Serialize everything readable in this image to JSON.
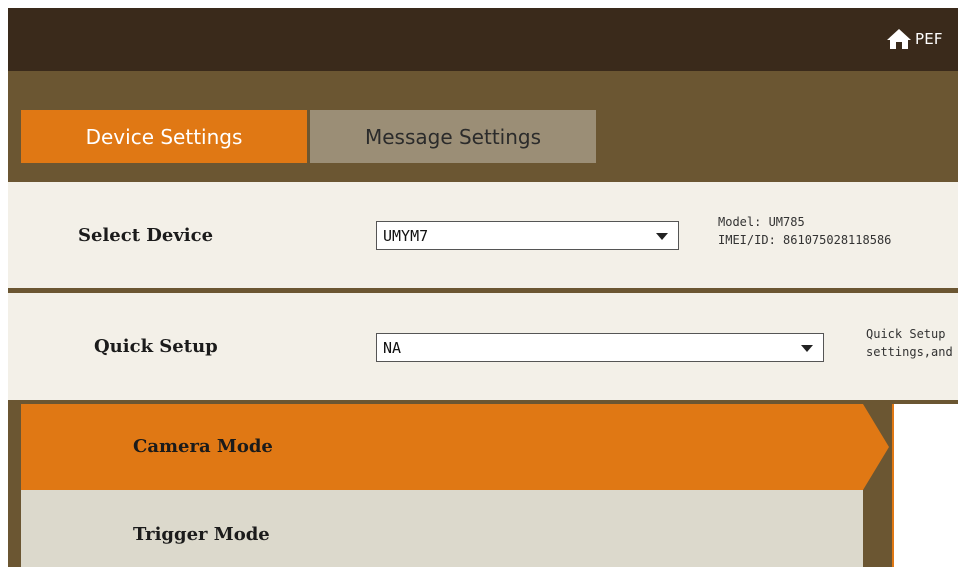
{
  "header": {
    "home_text": "PEF",
    "home_icon": "home-icon"
  },
  "tabs": [
    {
      "label": "Device Settings",
      "active": true
    },
    {
      "label": "Message Settings",
      "active": false
    }
  ],
  "select_device": {
    "label": "Select Device",
    "value": "UMYM7",
    "model_line": "Model: UM785",
    "imei_line": "IMEI/ID: 861075028118586"
  },
  "quick_setup": {
    "label": "Quick Setup",
    "value": "NA",
    "info_line1": "Quick Setup",
    "info_line2": "settings,and"
  },
  "modes": [
    {
      "label": "Camera Mode",
      "active": true
    },
    {
      "label": "Trigger Mode",
      "active": false
    }
  ],
  "colors": {
    "accent": "#e07814",
    "header": "#3a2a1b",
    "frame": "#6b5632"
  }
}
